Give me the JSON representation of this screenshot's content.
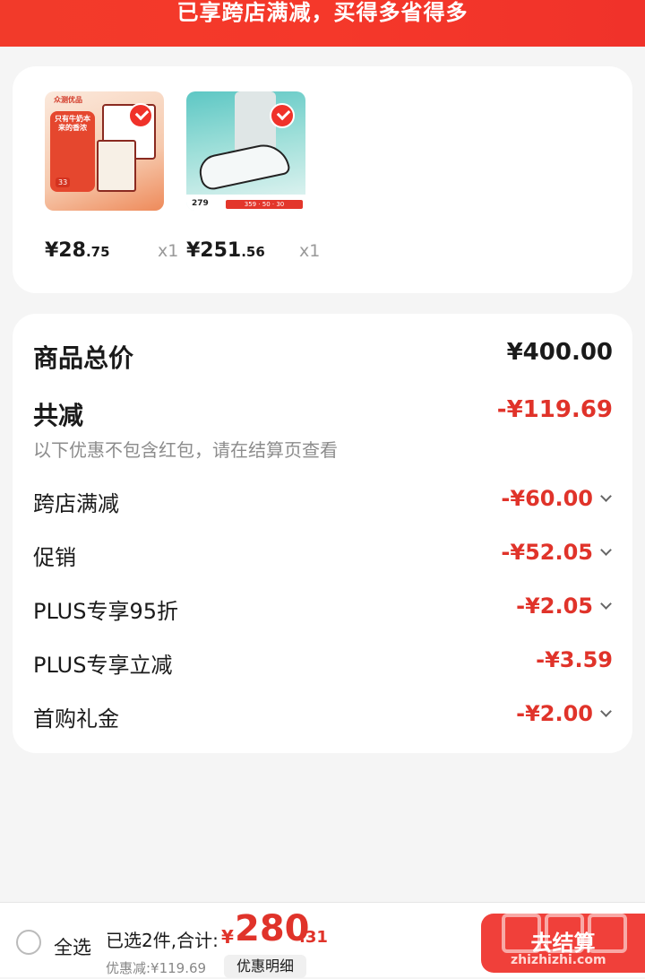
{
  "banner": {
    "text": "已享跨店满减，买得多省得多"
  },
  "products": [
    {
      "name": "milk",
      "price_int": "¥28",
      "price_dec": ".75",
      "qty": "x1",
      "tag": "众测优品",
      "label": "只有牛奶本来的香浓",
      "badge": "33"
    },
    {
      "name": "shoe",
      "price_int": "¥251",
      "price_dec": ".56",
      "qty": "x1",
      "tag": "279",
      "strip": "359 · 50 · 30"
    }
  ],
  "summary": {
    "total_label": "商品总价",
    "total_value": "¥400.00",
    "reduce_label": "共减",
    "reduce_value": "-¥119.69",
    "note": "以下优惠不包含红包，请在结算页查看",
    "items": [
      {
        "label": "跨店满减",
        "value": "-¥60.00",
        "expandable": true
      },
      {
        "label": "促销",
        "value": "-¥52.05",
        "expandable": true
      },
      {
        "label": "PLUS专享95折",
        "value": "-¥2.05",
        "expandable": true
      },
      {
        "label": "PLUS专享立减",
        "value": "-¥3.59",
        "expandable": false
      },
      {
        "label": "首购礼金",
        "value": "-¥2.00",
        "expandable": true
      }
    ]
  },
  "bottom": {
    "select_all": "全选",
    "selected": "已选2件,合计:",
    "yen": "¥",
    "total_int": "280",
    "total_dec": ".31",
    "discount": "优惠减:¥119.69",
    "detail_button": "优惠明细",
    "checkout": "去结算",
    "watermark_site": "zhizhizhi.com"
  },
  "colors": {
    "accent": "#e0332a",
    "banner": "#f23a2a",
    "checkout": "#f0403a"
  }
}
